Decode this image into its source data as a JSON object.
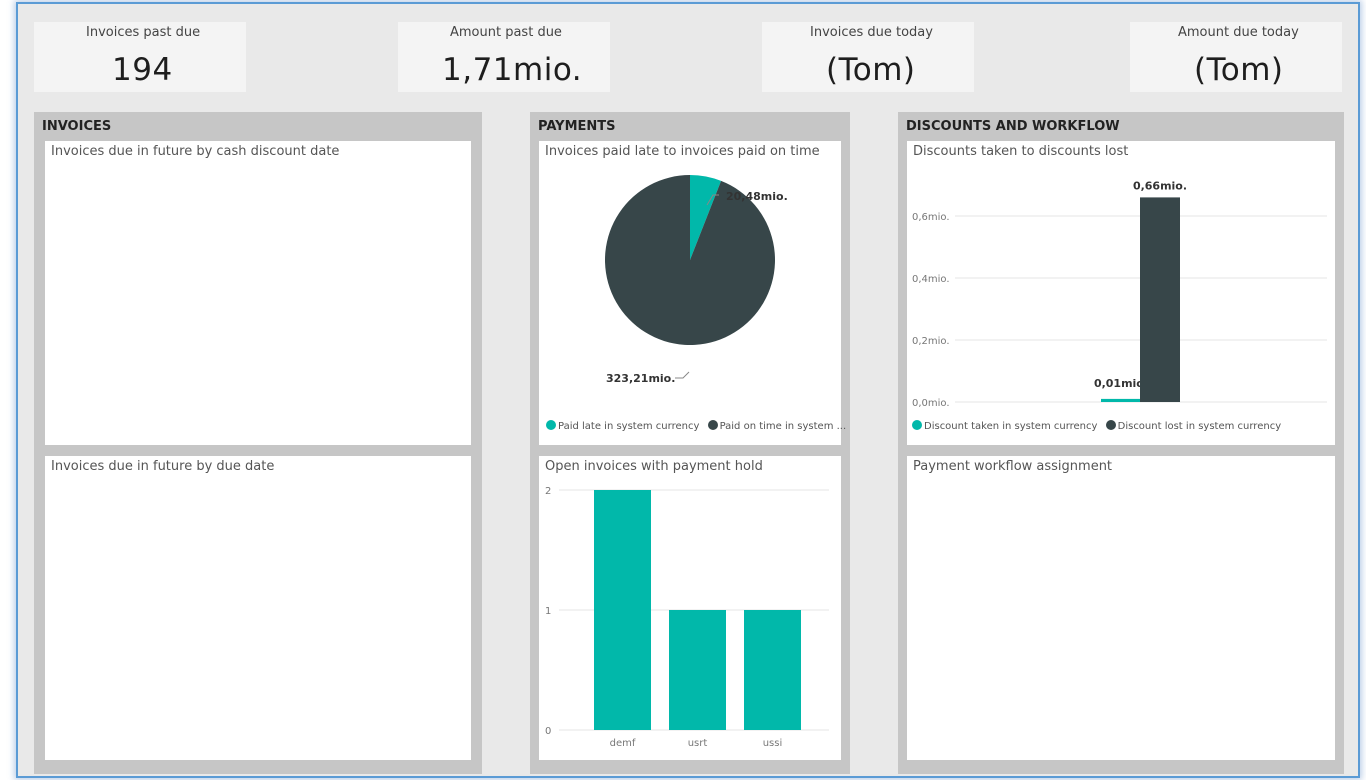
{
  "kpis": [
    {
      "title": "Invoices past due",
      "value": "194"
    },
    {
      "title": "Amount past due",
      "value": "1,71mio."
    },
    {
      "title": "Invoices due today",
      "value": "(Tom)"
    },
    {
      "title": "Amount due today",
      "value": "(Tom)"
    }
  ],
  "panels": {
    "invoices": {
      "title": "INVOICES",
      "cards": {
        "cash_discount": {
          "title": "Invoices due in future by cash discount date"
        },
        "due_date": {
          "title": "Invoices due in future by due date"
        }
      }
    },
    "payments": {
      "title": "PAYMENTS",
      "cards": {
        "late_vs_ontime": {
          "title": "Invoices paid late to invoices paid on time",
          "legend": [
            "Paid late in system currency",
            "Paid on time in system ..."
          ]
        },
        "payment_hold": {
          "title": "Open invoices with payment hold"
        }
      }
    },
    "discounts": {
      "title": "DISCOUNTS AND WORKFLOW",
      "cards": {
        "discounts": {
          "title": "Discounts taken to discounts lost",
          "legend": [
            "Discount taken in system currency",
            "Discount lost in system currency"
          ]
        },
        "workflow": {
          "title": "Payment workflow assignment"
        }
      }
    }
  },
  "colors": {
    "teal": "#01b8aa",
    "dark": "#374649"
  },
  "chart_data": [
    {
      "type": "pie",
      "title": "Invoices paid late to invoices paid on time",
      "labels": [
        "Paid late in system currency",
        "Paid on time in system currency"
      ],
      "values": [
        20.48,
        323.21
      ],
      "data_labels": [
        "20,48mio.",
        "323,21mio."
      ],
      "colors": [
        "#01b8aa",
        "#374649"
      ]
    },
    {
      "type": "bar",
      "title": "Open invoices with payment hold",
      "categories": [
        "demf",
        "usrt",
        "ussi"
      ],
      "values": [
        2,
        1,
        1
      ],
      "yticks": [
        "0",
        "1",
        "2"
      ],
      "ylim": [
        0,
        2
      ],
      "color": "#01b8aa"
    },
    {
      "type": "bar",
      "title": "Discounts taken to discounts lost",
      "series": [
        {
          "name": "Discount taken in system currency",
          "values": [
            0.01
          ],
          "data_label": "0,01mio.",
          "color": "#01b8aa"
        },
        {
          "name": "Discount lost in system currency",
          "values": [
            0.66
          ],
          "data_label": "0,66mio.",
          "color": "#374649"
        }
      ],
      "yticks": [
        "0,0mio.",
        "0,2mio.",
        "0,4mio.",
        "0,6mio."
      ],
      "ylim": [
        0,
        0.6
      ]
    }
  ]
}
